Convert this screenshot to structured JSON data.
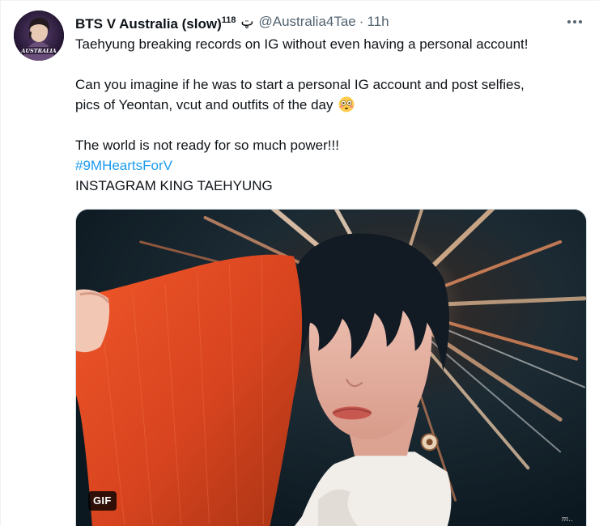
{
  "author": {
    "display_name": "BTS V Australia (slow)",
    "superscript": "118",
    "name_glyph": "ټ",
    "handle": "@Australia4Tae",
    "separator": "·",
    "time": "11h",
    "avatar_text": "AUSTRALIA"
  },
  "tweet": {
    "line1": "Taehyung breaking records on IG without even having a personal account!",
    "line2": "Can you imagine if he was to start a personal IG account and post selfies,",
    "line3": "pics of Yeontan, vcut and outfits of the day",
    "line3_emoji": "flushed-face-emoji",
    "line4": "The world is not ready for so much power!!!",
    "hashtag": "#9MHeartsForV",
    "line5": "INSTAGRAM KING TAEHYUNG"
  },
  "media": {
    "badge": "GIF",
    "watermark": "m.."
  },
  "colors": {
    "text": "#0f1419",
    "secondary": "#536471",
    "link": "#1d9bf0",
    "border": "#cfd9de"
  },
  "icons": {
    "more": "more-horizontal-icon"
  }
}
